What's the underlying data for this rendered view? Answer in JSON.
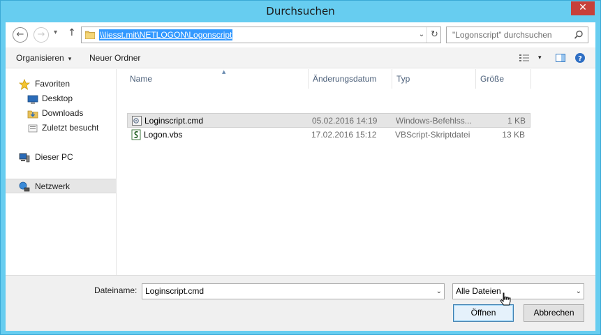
{
  "window": {
    "title": "Durchsuchen",
    "close_glyph": "✕"
  },
  "address": {
    "path": "\\\\liesst.mit\\NETLOGON\\Logonscript",
    "back_glyph": "←",
    "forward_glyph": "→",
    "recent_glyph": "▾",
    "up_glyph": "↑",
    "dropdown_glyph": "⌄",
    "refresh_glyph": "↻"
  },
  "search": {
    "placeholder": "\"Logonscript\" durchsuchen"
  },
  "toolbar": {
    "organize_label": "Organisieren",
    "organize_caret": "▾",
    "new_folder_label": "Neuer Ordner",
    "view_caret": "▾"
  },
  "navpane": {
    "items": [
      {
        "label": "Favoriten",
        "icon": "star-icon"
      },
      {
        "label": "Desktop",
        "icon": "desktop-icon"
      },
      {
        "label": "Downloads",
        "icon": "downloads-icon"
      },
      {
        "label": "Zuletzt besucht",
        "icon": "recent-places-icon"
      },
      {
        "label": "Dieser PC",
        "icon": "computer-icon"
      },
      {
        "label": "Netzwerk",
        "icon": "network-icon"
      }
    ]
  },
  "filelist": {
    "columns": [
      "Name",
      "Änderungsdatum",
      "Typ",
      "Größe"
    ],
    "sort_arrow": "▲",
    "rows": [
      {
        "name": "Loginscript.cmd",
        "date": "05.02.2016 14:19",
        "type": "Windows-Befehlss...",
        "size": "1 KB",
        "icon": "cmd-file-icon"
      },
      {
        "name": "Logon.vbs",
        "date": "17.02.2016 15:12",
        "type": "VBScript-Skriptdatei",
        "size": "13 KB",
        "icon": "vbs-file-icon"
      }
    ]
  },
  "bottom": {
    "filename_label": "Dateiname:",
    "filename_value": "Loginscript.cmd",
    "filter_value": "Alle Dateien",
    "combo_glyph": "⌄",
    "open_label": "Öffnen",
    "cancel_label": "Abbrechen"
  },
  "colors": {
    "title_bar": "#67cdf0",
    "selection": "#3399ff",
    "close_button": "#c7403a"
  }
}
